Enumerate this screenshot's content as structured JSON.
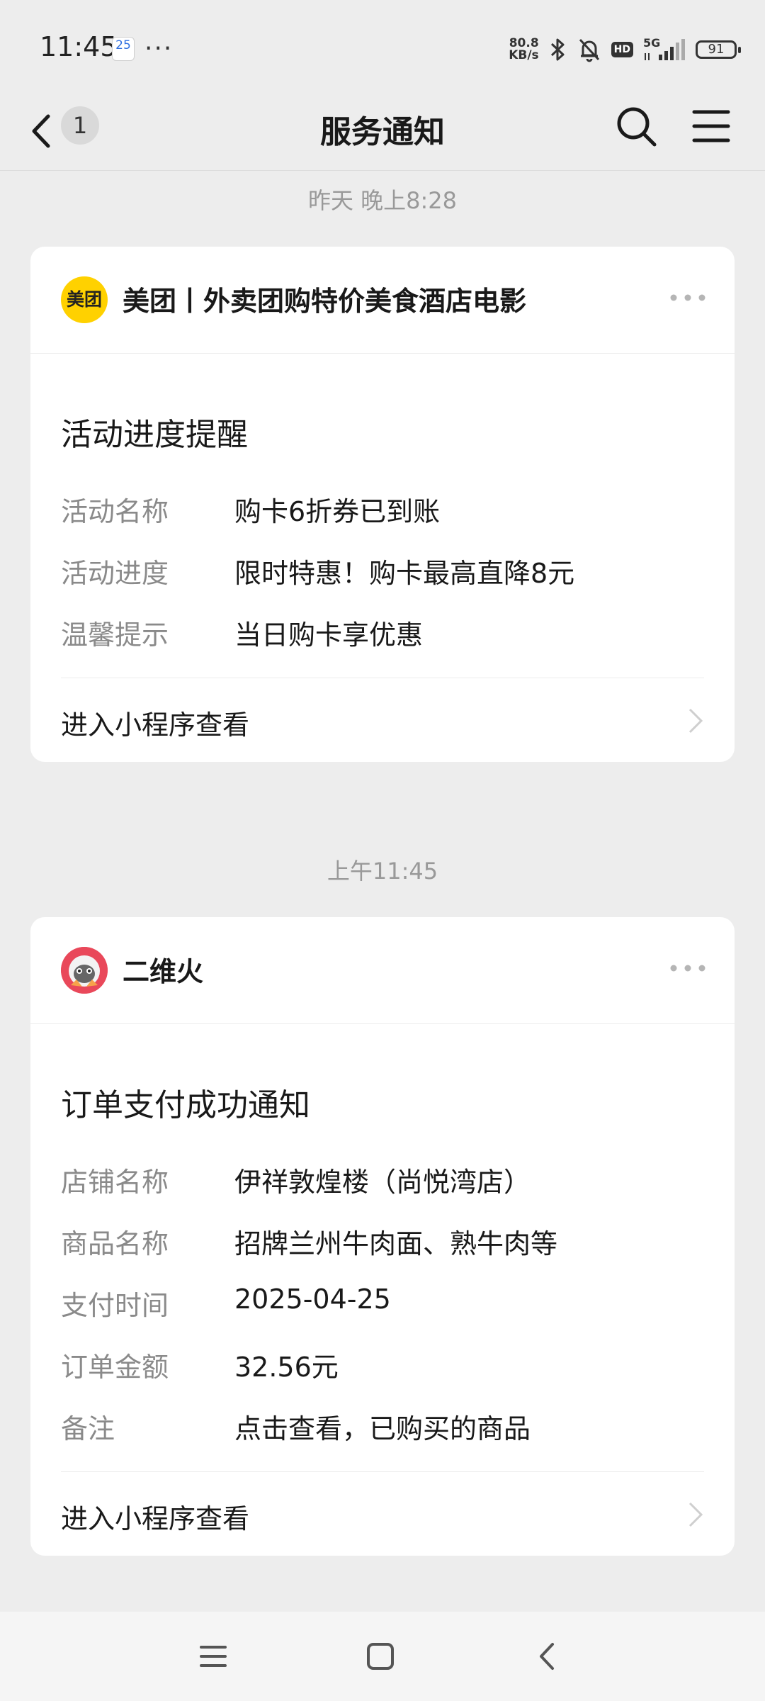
{
  "status_bar": {
    "time": "11:45",
    "calendar_day": "25",
    "more_dots": "···",
    "net_speed_value": "80.8",
    "net_speed_unit": "KB/s",
    "signal_label": "5G",
    "hd_label": "HD",
    "battery": "91",
    "icons": [
      "calendar-icon",
      "bluetooth-icon",
      "mute-bell-icon",
      "hd-icon",
      "signal-icon",
      "battery-icon"
    ]
  },
  "nav": {
    "title": "服务通知",
    "unread_count": "1",
    "icons": [
      "back-icon",
      "search-icon",
      "menu-icon"
    ]
  },
  "messages": [
    {
      "timestamp": "昨天 晚上8:28",
      "sender": "美团丨外卖团购特价美食酒店电影",
      "logo_text": "美团",
      "title": "活动进度提醒",
      "rows": [
        {
          "label": "活动名称",
          "value": "购卡6折券已到账"
        },
        {
          "label": "活动进度",
          "value": "限时特惠！购卡最高直降8元"
        },
        {
          "label": "温馨提示",
          "value": "当日购卡享优惠"
        }
      ],
      "footer": "进入小程序查看"
    },
    {
      "timestamp": "上午11:45",
      "sender": "二维火",
      "title": "订单支付成功通知",
      "rows": [
        {
          "label": "店铺名称",
          "value": "伊祥敦煌楼（尚悦湾店）"
        },
        {
          "label": "商品名称",
          "value": "招牌兰州牛肉面、熟牛肉等"
        },
        {
          "label": "支付时间",
          "value": "2025-04-25"
        },
        {
          "label": "订单金额",
          "value": "32.56元"
        },
        {
          "label": "备注",
          "value": "点击查看，已购买的商品"
        }
      ],
      "footer": "进入小程序查看"
    }
  ],
  "system_nav": {
    "icons": [
      "recents-icon",
      "home-icon",
      "system-back-icon"
    ]
  },
  "colors": {
    "background": "#ededed",
    "card": "#ffffff",
    "label_gray": "#8a8a8a",
    "meituan_yellow": "#ffd100",
    "erweihuo_red": "#e9485a"
  }
}
